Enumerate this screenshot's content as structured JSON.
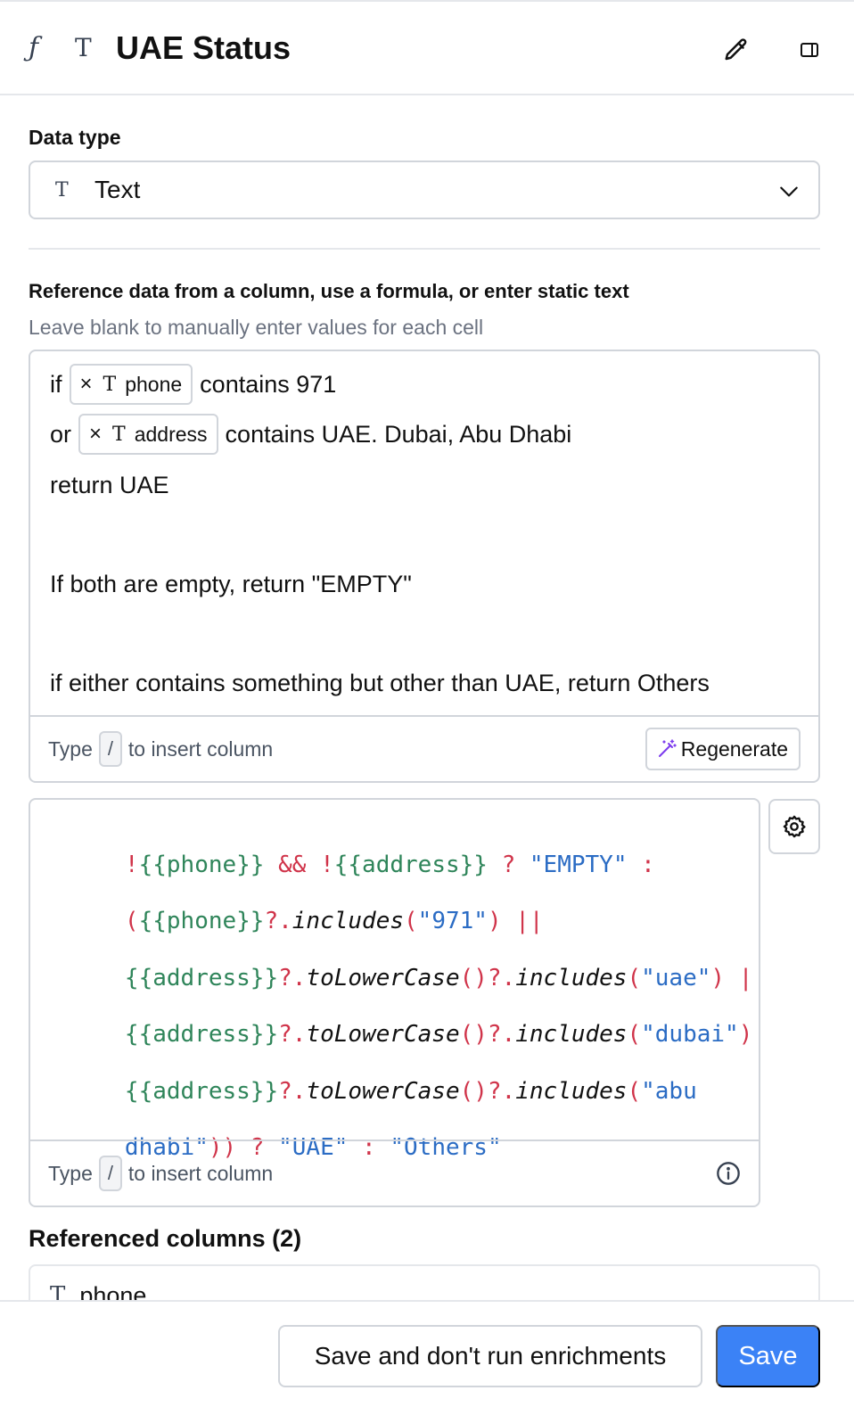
{
  "header": {
    "function_icon": "ƒ",
    "text_type_icon": "T",
    "title": "UAE Status",
    "edit_icon": "pencil-icon",
    "panel_icon": "sidebar-icon"
  },
  "data_type": {
    "label": "Data type",
    "selected_icon": "T",
    "selected": "Text"
  },
  "reference": {
    "title": "Reference data from a column, use a formula, or enter static text",
    "subtitle": "Leave blank to manually enter values for each cell",
    "prompt": {
      "line1_prefix": "if",
      "chip1": "phone",
      "line1_suffix": "contains 971",
      "line2_prefix": "or",
      "chip2": "address",
      "line2_suffix": "contains UAE. Dubai, Abu Dhabi",
      "line3": "return UAE",
      "line5": "If both are empty, return \"EMPTY\"",
      "line7": "if either contains something but other than UAE, return Others"
    },
    "chip_remove_icon": "×",
    "chip_type_icon": "T",
    "footer_prefix": "Type",
    "footer_key": "/",
    "footer_suffix": "to insert column",
    "regenerate_label": "Regenerate"
  },
  "formula": {
    "l1": [
      "!",
      "{{phone}}",
      " && ",
      "!",
      "{{address}}",
      " ? ",
      "\"EMPTY\"",
      " :"
    ],
    "l2": [
      "(",
      "{{phone}}",
      "?.",
      "includes",
      "(",
      "\"971\"",
      ") ||"
    ],
    "l3": [
      "{{address}}",
      "?.",
      "toLowerCase",
      "()",
      "?.",
      "includes",
      "(",
      "\"uae\"",
      ") ||"
    ],
    "l4": [
      "{{address}}",
      "?.",
      "toLowerCase",
      "()",
      "?.",
      "includes",
      "(",
      "\"dubai\"",
      ") ||"
    ],
    "l5": [
      "{{address}}",
      "?.",
      "toLowerCase",
      "()",
      "?.",
      "includes",
      "(",
      "\"abu"
    ],
    "l6": [
      "dhabi\"",
      ")) ? ",
      "\"UAE\"",
      " : ",
      "\"Others\""
    ],
    "footer_prefix": "Type",
    "footer_key": "/",
    "footer_suffix": "to insert column"
  },
  "referenced_columns": {
    "title": "Referenced columns (2)",
    "items": [
      {
        "icon": "T",
        "name": "phone"
      }
    ]
  },
  "footer": {
    "secondary_label": "Save and don't run enrichments",
    "primary_label": "Save"
  },
  "colors": {
    "primary": "#3b82f6",
    "code_green": "#2f855a",
    "code_red": "#d0344a",
    "code_blue": "#2b6cc4"
  }
}
